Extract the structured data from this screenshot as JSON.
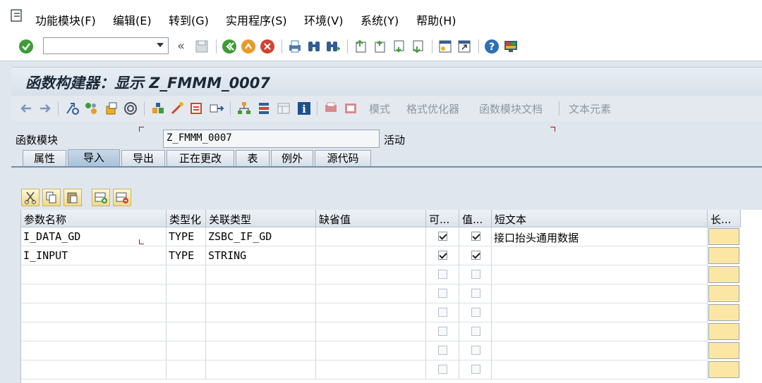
{
  "menu": {
    "items": [
      "功能模块(F)",
      "编辑(E)",
      "转到(G)",
      "实用程序(S)",
      "环境(V)",
      "系统(Y)",
      "帮助(H)"
    ]
  },
  "toolbar": {
    "command_value": "",
    "back_glyph": "«"
  },
  "title": "函数构建器：显示 Z_FMMM_0007",
  "app_toolbar": {
    "buttons": [
      "模式",
      "格式优化器",
      "函数模块文档",
      "文本元素"
    ]
  },
  "function_module": {
    "label": "函数模块",
    "value": "Z_FMMM_0007",
    "status": "活动"
  },
  "tabs": [
    {
      "label": "属性",
      "active": false
    },
    {
      "label": "导入",
      "active": true
    },
    {
      "label": "导出",
      "active": false
    },
    {
      "label": "正在更改",
      "active": false
    },
    {
      "label": "表",
      "active": false
    },
    {
      "label": "例外",
      "active": false
    },
    {
      "label": "源代码",
      "active": false
    }
  ],
  "table": {
    "headers": [
      "参数名称",
      "类型化",
      "关联类型",
      "缺省值",
      "可...",
      "值...",
      "短文本",
      "长..."
    ],
    "rows": [
      {
        "name": "I_DATA_GD",
        "typing": "TYPE",
        "assoc_type": "ZSBC_IF_GD",
        "default": "",
        "optional": true,
        "pass_value": true,
        "short_text": "接口抬头通用数据"
      },
      {
        "name": "I_INPUT",
        "typing": "TYPE",
        "assoc_type": "STRING",
        "default": "",
        "optional": true,
        "pass_value": true,
        "short_text": ""
      }
    ],
    "empty_rows": 6
  },
  "colors": {
    "accent": "#6f8fb0",
    "long_text_button": "#fbe7a3",
    "menu_bg": "#ffffff",
    "panel_bg": "#dfe6ee"
  },
  "icons": {
    "toolbar": [
      "check-icon",
      "save-icon",
      "back-icon",
      "exit-icon",
      "cancel-icon",
      "print-icon",
      "find-icon",
      "find-next-icon",
      "first-page-icon",
      "prev-page-icon",
      "next-page-icon",
      "last-page-icon",
      "new-session-icon",
      "shortcut-icon",
      "help-icon",
      "layout-icon"
    ],
    "app_toolbar": [
      "back-arrow-icon",
      "forward-arrow-icon",
      "other-object-icon",
      "display-change-icon",
      "check-syntax-icon",
      "activate-icon",
      "where-used-icon",
      "test-icon",
      "pattern-icon",
      "pretty-print-icon",
      "hierarchy-icon",
      "stack-icon",
      "window-icon",
      "info-icon"
    ]
  }
}
